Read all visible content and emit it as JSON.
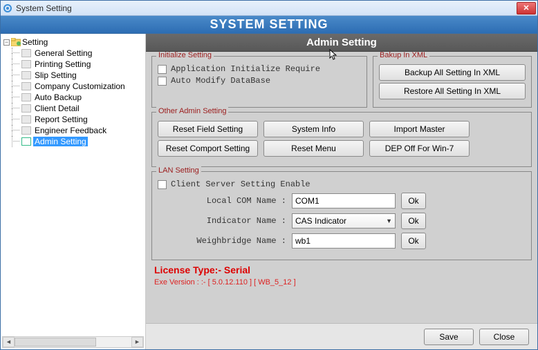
{
  "window": {
    "title": "System Setting"
  },
  "banner": "SYSTEM SETTING",
  "tree": {
    "root": "Setting",
    "items": [
      {
        "label": "General Setting"
      },
      {
        "label": "Printing Setting"
      },
      {
        "label": "Slip Setting"
      },
      {
        "label": "Company Customization"
      },
      {
        "label": "Auto Backup"
      },
      {
        "label": "Client Detail"
      },
      {
        "label": "Report Setting"
      },
      {
        "label": "Engineer Feedback"
      },
      {
        "label": "Admin Setting",
        "selected": true
      }
    ]
  },
  "section_title": "Admin Setting",
  "init": {
    "legend": "Initialize Setting",
    "opt1": "Application Initialize Require",
    "opt2": "Auto Modify DataBase"
  },
  "backup": {
    "legend": "Bakup In XML",
    "btn_backup": "Backup All Setting In XML",
    "btn_restore": "Restore All Setting In XML"
  },
  "other": {
    "legend": "Other Admin Setting",
    "btn_reset_field": "Reset Field Setting",
    "btn_system_info": "System Info",
    "btn_import_master": "Import Master",
    "btn_reset_comport": "Reset Comport Setting",
    "btn_reset_menu": "Reset Menu",
    "btn_dep_off": "DEP Off For Win-7"
  },
  "lan": {
    "legend": "LAN Setting",
    "chk_client_server": "Client Server Setting Enable",
    "local_com_label": "Local COM Name :",
    "local_com_value": "COM1",
    "indicator_label": "Indicator Name :",
    "indicator_value": "CAS Indicator",
    "weighbridge_label": "Weighbridge Name :",
    "weighbridge_value": "wb1",
    "ok": "Ok"
  },
  "license": {
    "title": "License Type:- Serial",
    "version": "Exe Version : :-  [ 5.0.12.110 ] [ WB_5_12 ]"
  },
  "footer": {
    "save": "Save",
    "close": "Close"
  }
}
